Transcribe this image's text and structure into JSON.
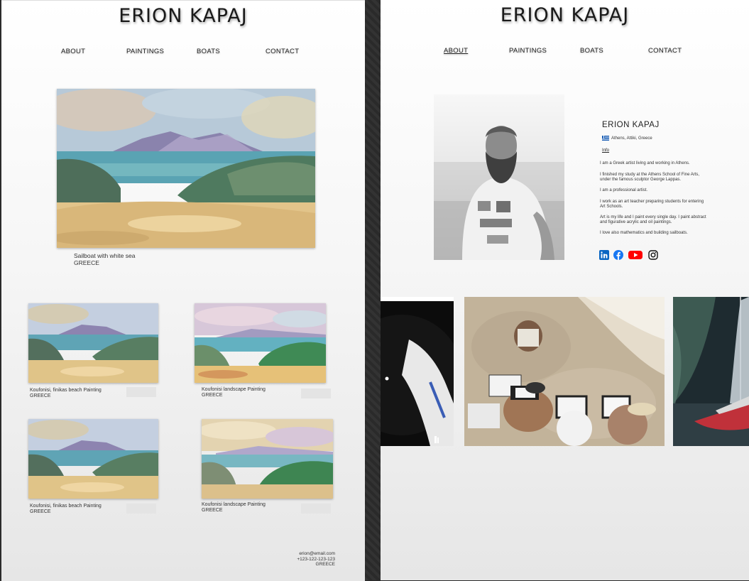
{
  "site": {
    "title": "ERION KAPAJ",
    "nav": [
      "ABOUT",
      "PAINTINGS",
      "BOATS",
      "CONTACT"
    ]
  },
  "left_page": {
    "featured": {
      "title": "Sailboat with white sea",
      "location": "GREECE"
    },
    "gallery": [
      {
        "title": "Koufonisi, finikas beach Painting",
        "location": "GREECE"
      },
      {
        "title": "Koufonisi landscape Painting",
        "location": "GREECE"
      },
      {
        "title": "Koufonisi, finikas beach Painting",
        "location": "GREECE"
      },
      {
        "title": "Koufonisi landscape Painting",
        "location": "GREECE"
      }
    ],
    "footer": {
      "email": "erion@email.com",
      "phone": "+123-122-123-123",
      "country": "GREECE"
    }
  },
  "right_page": {
    "active_nav": "ABOUT",
    "bio": {
      "name": "ERION KAPAJ",
      "location": "Athens, Attiki, Greece",
      "info_link": "Info",
      "paragraphs": [
        "I am a Greek artist living and working in Athens.",
        "I finished my study at the Athens School of Fine Arts, under the famous sculptor George Lappas.",
        "I am a professional artist.",
        "I work as an art teacher preparing students for entering Art Schools.",
        "Art is my life and I paint every single day. I paint abstract and figurative acrylic and oil paintings.",
        "I love also mathematics and building sailboats."
      ]
    },
    "social": [
      "linkedin-icon",
      "facebook-icon",
      "youtube-icon",
      "instagram-icon"
    ],
    "colors": {
      "linkedin": "#0a66c2",
      "facebook": "#1877f2",
      "youtube": "#ff0000",
      "instagram": "#111111"
    }
  }
}
